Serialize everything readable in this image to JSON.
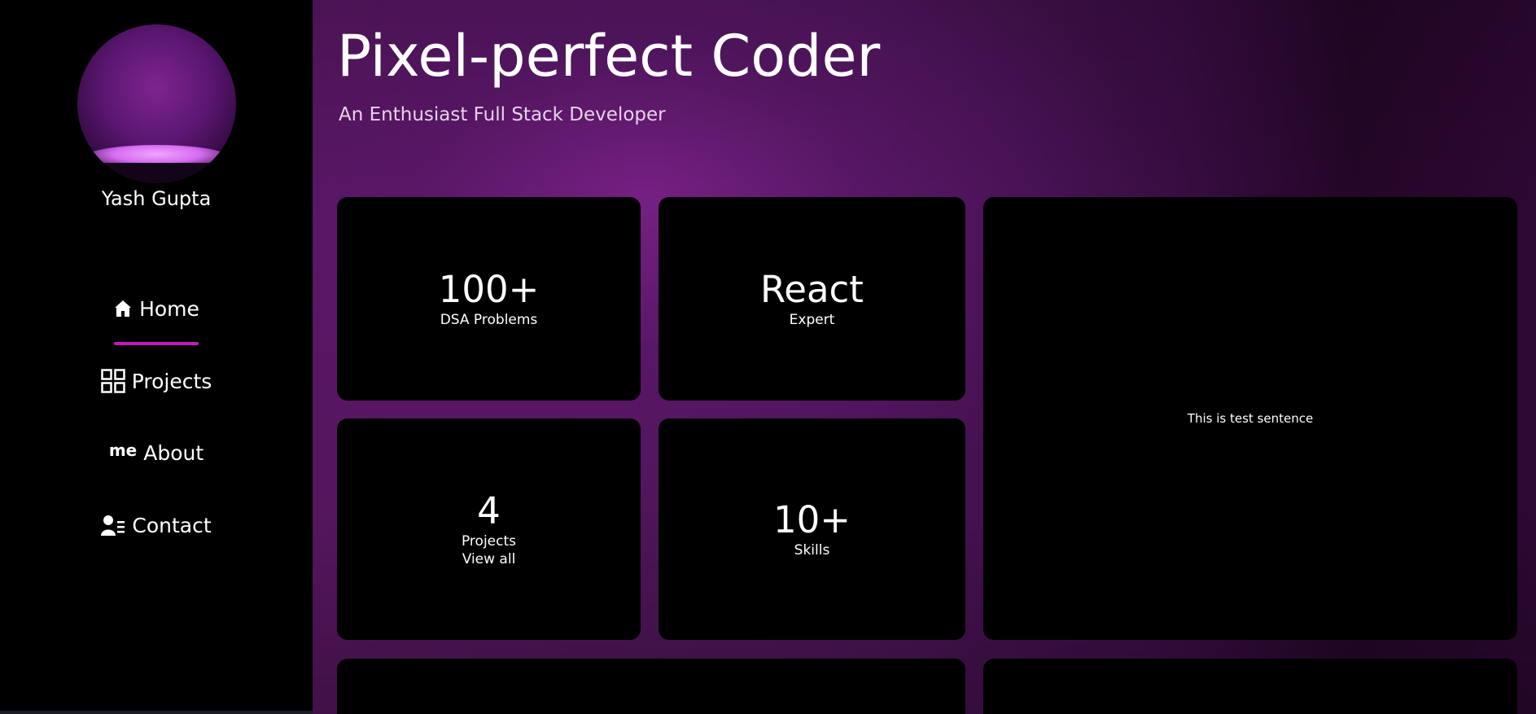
{
  "profile": {
    "name": "Yash Gupta"
  },
  "nav": {
    "items": [
      {
        "label": "Home",
        "icon": "home-icon",
        "active": true
      },
      {
        "label": "Projects",
        "icon": "grid-icon"
      },
      {
        "label": "About",
        "icon": "me-icon",
        "icon_text": "me"
      },
      {
        "label": "Contact",
        "icon": "contact-icon"
      }
    ]
  },
  "hero": {
    "title": "Pixel-perfect Coder",
    "subtitle": "An Enthusiast Full Stack Developer"
  },
  "cards": {
    "dsa": {
      "value": "100+",
      "label": "DSA Problems"
    },
    "react": {
      "value": "React",
      "label": "Expert"
    },
    "projects": {
      "value": "4",
      "label": "Projects",
      "link": "View all"
    },
    "skills": {
      "value": "10+",
      "label": "Skills"
    },
    "test": {
      "text": "This is test sentence"
    }
  },
  "colors": {
    "accent": "#c21bbd",
    "card_bg": "#000000",
    "sidebar_bg": "#000000",
    "background": "#4b1456"
  }
}
